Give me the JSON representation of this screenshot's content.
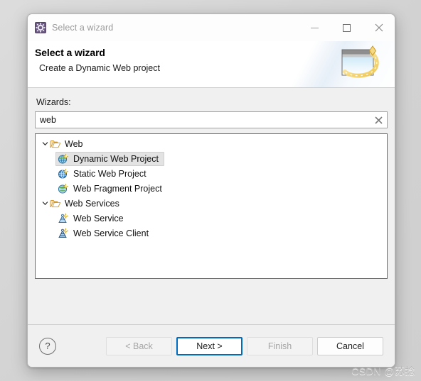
{
  "window": {
    "title": "Select a wizard",
    "title_icon": "wizard-gear-icon",
    "controls": {
      "minimize": "minimize-icon",
      "maximize": "maximize-icon",
      "close": "close-icon"
    }
  },
  "banner": {
    "heading": "Select a wizard",
    "description": "Create a Dynamic Web project",
    "art": "wizard-window-sparkle-icon"
  },
  "filter": {
    "label": "Wizards:",
    "value": "web",
    "placeholder": "",
    "clear_icon": "clear-icon"
  },
  "tree": {
    "nodes": [
      {
        "label": "Web",
        "type": "folder",
        "icon": "open-folder-icon",
        "expanded": true,
        "twisty": "chevron-down-icon",
        "children": [
          {
            "label": "Dynamic Web Project",
            "icon": "globe-new-icon",
            "selected": true
          },
          {
            "label": "Static Web Project",
            "icon": "globe-blue-new-icon",
            "selected": false
          },
          {
            "label": "Web Fragment Project",
            "icon": "globe-green-new-icon",
            "selected": false
          }
        ]
      },
      {
        "label": "Web Services",
        "type": "folder",
        "icon": "open-folder-icon",
        "expanded": true,
        "twisty": "chevron-down-icon",
        "children": [
          {
            "label": "Web Service",
            "icon": "web-service-new-icon",
            "selected": false
          },
          {
            "label": "Web Service Client",
            "icon": "web-service-client-new-icon",
            "selected": false
          }
        ]
      }
    ]
  },
  "buttons": {
    "help": "?",
    "back": "< Back",
    "next": "Next >",
    "finish": "Finish",
    "cancel": "Cancel"
  },
  "watermark": "CSDN @苏捻",
  "colors": {
    "accent": "#0069c0",
    "selection": "#e3e3e3",
    "dialog_bg": "#f0f0f0",
    "folder": "#f0b95a"
  }
}
